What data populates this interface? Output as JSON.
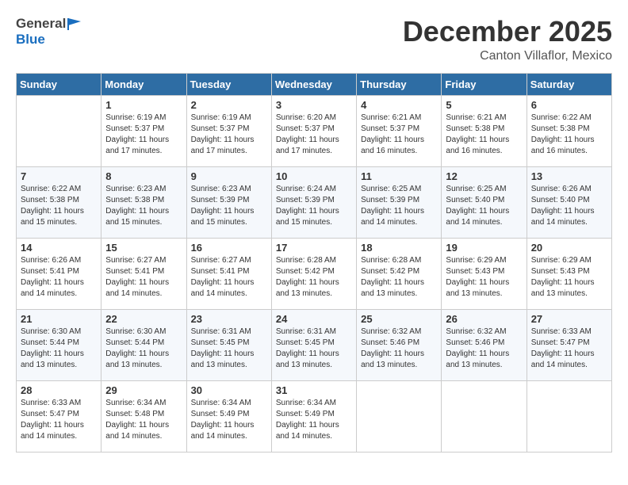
{
  "logo": {
    "general": "General",
    "blue": "Blue"
  },
  "header": {
    "month": "December 2025",
    "location": "Canton Villaflor, Mexico"
  },
  "days_of_week": [
    "Sunday",
    "Monday",
    "Tuesday",
    "Wednesday",
    "Thursday",
    "Friday",
    "Saturday"
  ],
  "weeks": [
    [
      {
        "day": "",
        "sunrise": "",
        "sunset": "",
        "daylight": ""
      },
      {
        "day": "1",
        "sunrise": "Sunrise: 6:19 AM",
        "sunset": "Sunset: 5:37 PM",
        "daylight": "Daylight: 11 hours and 17 minutes."
      },
      {
        "day": "2",
        "sunrise": "Sunrise: 6:19 AM",
        "sunset": "Sunset: 5:37 PM",
        "daylight": "Daylight: 11 hours and 17 minutes."
      },
      {
        "day": "3",
        "sunrise": "Sunrise: 6:20 AM",
        "sunset": "Sunset: 5:37 PM",
        "daylight": "Daylight: 11 hours and 17 minutes."
      },
      {
        "day": "4",
        "sunrise": "Sunrise: 6:21 AM",
        "sunset": "Sunset: 5:37 PM",
        "daylight": "Daylight: 11 hours and 16 minutes."
      },
      {
        "day": "5",
        "sunrise": "Sunrise: 6:21 AM",
        "sunset": "Sunset: 5:38 PM",
        "daylight": "Daylight: 11 hours and 16 minutes."
      },
      {
        "day": "6",
        "sunrise": "Sunrise: 6:22 AM",
        "sunset": "Sunset: 5:38 PM",
        "daylight": "Daylight: 11 hours and 16 minutes."
      }
    ],
    [
      {
        "day": "7",
        "sunrise": "Sunrise: 6:22 AM",
        "sunset": "Sunset: 5:38 PM",
        "daylight": "Daylight: 11 hours and 15 minutes."
      },
      {
        "day": "8",
        "sunrise": "Sunrise: 6:23 AM",
        "sunset": "Sunset: 5:38 PM",
        "daylight": "Daylight: 11 hours and 15 minutes."
      },
      {
        "day": "9",
        "sunrise": "Sunrise: 6:23 AM",
        "sunset": "Sunset: 5:39 PM",
        "daylight": "Daylight: 11 hours and 15 minutes."
      },
      {
        "day": "10",
        "sunrise": "Sunrise: 6:24 AM",
        "sunset": "Sunset: 5:39 PM",
        "daylight": "Daylight: 11 hours and 15 minutes."
      },
      {
        "day": "11",
        "sunrise": "Sunrise: 6:25 AM",
        "sunset": "Sunset: 5:39 PM",
        "daylight": "Daylight: 11 hours and 14 minutes."
      },
      {
        "day": "12",
        "sunrise": "Sunrise: 6:25 AM",
        "sunset": "Sunset: 5:40 PM",
        "daylight": "Daylight: 11 hours and 14 minutes."
      },
      {
        "day": "13",
        "sunrise": "Sunrise: 6:26 AM",
        "sunset": "Sunset: 5:40 PM",
        "daylight": "Daylight: 11 hours and 14 minutes."
      }
    ],
    [
      {
        "day": "14",
        "sunrise": "Sunrise: 6:26 AM",
        "sunset": "Sunset: 5:41 PM",
        "daylight": "Daylight: 11 hours and 14 minutes."
      },
      {
        "day": "15",
        "sunrise": "Sunrise: 6:27 AM",
        "sunset": "Sunset: 5:41 PM",
        "daylight": "Daylight: 11 hours and 14 minutes."
      },
      {
        "day": "16",
        "sunrise": "Sunrise: 6:27 AM",
        "sunset": "Sunset: 5:41 PM",
        "daylight": "Daylight: 11 hours and 14 minutes."
      },
      {
        "day": "17",
        "sunrise": "Sunrise: 6:28 AM",
        "sunset": "Sunset: 5:42 PM",
        "daylight": "Daylight: 11 hours and 13 minutes."
      },
      {
        "day": "18",
        "sunrise": "Sunrise: 6:28 AM",
        "sunset": "Sunset: 5:42 PM",
        "daylight": "Daylight: 11 hours and 13 minutes."
      },
      {
        "day": "19",
        "sunrise": "Sunrise: 6:29 AM",
        "sunset": "Sunset: 5:43 PM",
        "daylight": "Daylight: 11 hours and 13 minutes."
      },
      {
        "day": "20",
        "sunrise": "Sunrise: 6:29 AM",
        "sunset": "Sunset: 5:43 PM",
        "daylight": "Daylight: 11 hours and 13 minutes."
      }
    ],
    [
      {
        "day": "21",
        "sunrise": "Sunrise: 6:30 AM",
        "sunset": "Sunset: 5:44 PM",
        "daylight": "Daylight: 11 hours and 13 minutes."
      },
      {
        "day": "22",
        "sunrise": "Sunrise: 6:30 AM",
        "sunset": "Sunset: 5:44 PM",
        "daylight": "Daylight: 11 hours and 13 minutes."
      },
      {
        "day": "23",
        "sunrise": "Sunrise: 6:31 AM",
        "sunset": "Sunset: 5:45 PM",
        "daylight": "Daylight: 11 hours and 13 minutes."
      },
      {
        "day": "24",
        "sunrise": "Sunrise: 6:31 AM",
        "sunset": "Sunset: 5:45 PM",
        "daylight": "Daylight: 11 hours and 13 minutes."
      },
      {
        "day": "25",
        "sunrise": "Sunrise: 6:32 AM",
        "sunset": "Sunset: 5:46 PM",
        "daylight": "Daylight: 11 hours and 13 minutes."
      },
      {
        "day": "26",
        "sunrise": "Sunrise: 6:32 AM",
        "sunset": "Sunset: 5:46 PM",
        "daylight": "Daylight: 11 hours and 13 minutes."
      },
      {
        "day": "27",
        "sunrise": "Sunrise: 6:33 AM",
        "sunset": "Sunset: 5:47 PM",
        "daylight": "Daylight: 11 hours and 14 minutes."
      }
    ],
    [
      {
        "day": "28",
        "sunrise": "Sunrise: 6:33 AM",
        "sunset": "Sunset: 5:47 PM",
        "daylight": "Daylight: 11 hours and 14 minutes."
      },
      {
        "day": "29",
        "sunrise": "Sunrise: 6:34 AM",
        "sunset": "Sunset: 5:48 PM",
        "daylight": "Daylight: 11 hours and 14 minutes."
      },
      {
        "day": "30",
        "sunrise": "Sunrise: 6:34 AM",
        "sunset": "Sunset: 5:49 PM",
        "daylight": "Daylight: 11 hours and 14 minutes."
      },
      {
        "day": "31",
        "sunrise": "Sunrise: 6:34 AM",
        "sunset": "Sunset: 5:49 PM",
        "daylight": "Daylight: 11 hours and 14 minutes."
      },
      {
        "day": "",
        "sunrise": "",
        "sunset": "",
        "daylight": ""
      },
      {
        "day": "",
        "sunrise": "",
        "sunset": "",
        "daylight": ""
      },
      {
        "day": "",
        "sunrise": "",
        "sunset": "",
        "daylight": ""
      }
    ]
  ]
}
